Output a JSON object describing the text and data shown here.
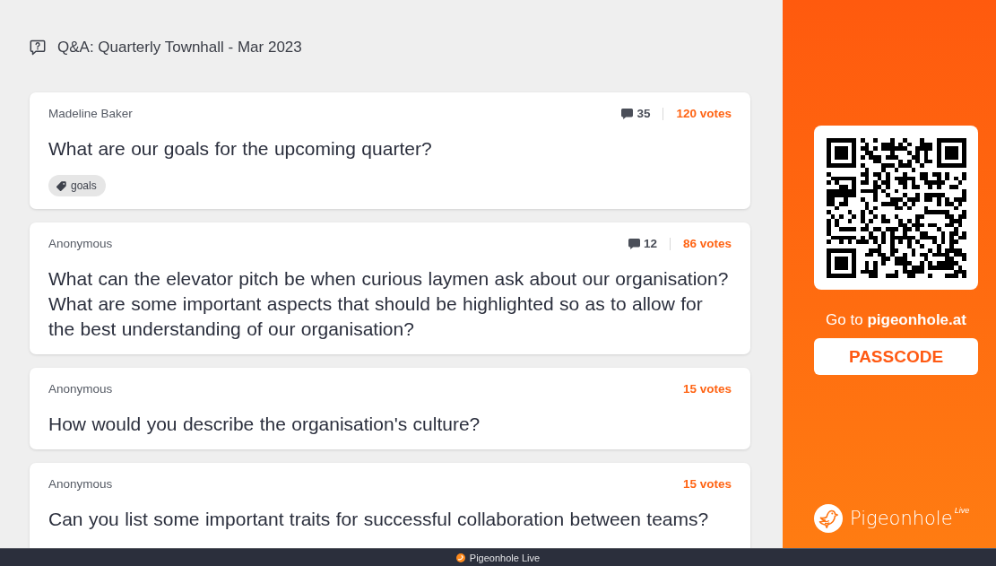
{
  "header": {
    "title": "Q&A: Quarterly Townhall - Mar 2023"
  },
  "questions": [
    {
      "author": "Madeline Baker",
      "comments": "35",
      "votes": "120 votes",
      "text": "What are our goals for the upcoming quarter?",
      "tags": [
        {
          "label": "goals"
        }
      ]
    },
    {
      "author": "Anonymous",
      "comments": "12",
      "votes": "86 votes",
      "text": "What can the elevator pitch be when curious laymen ask about our organisation? What are some important aspects that should be highlighted so as to allow for the best understanding of our organisation?"
    },
    {
      "author": "Anonymous",
      "votes": "15 votes",
      "text": "How would you describe the organisation's culture?"
    },
    {
      "author": "Anonymous",
      "votes": "15 votes",
      "text": "Can you list some important traits for successful collaboration between teams?"
    }
  ],
  "join_panel": {
    "instruction": "Go to **pigeonhole.at**",
    "passcode": "PASSCODE",
    "logo": {
      "name": "Pigeonhole",
      "badge": "Live"
    }
  },
  "footer": {
    "label": "Pigeonhole Live"
  }
}
